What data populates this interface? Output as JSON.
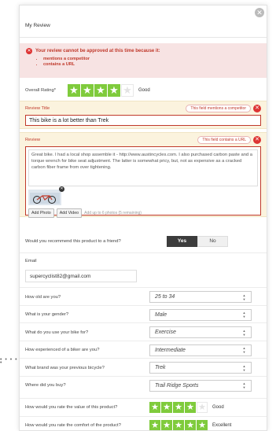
{
  "window": {
    "title": "My Review"
  },
  "alert": {
    "heading": "Your review cannot be approved at this time because it:",
    "reasons": [
      "mentions a competitor",
      "contains a URL"
    ]
  },
  "overall_rating": {
    "label": "Overall Rating*",
    "stars": 4,
    "max": 5,
    "text": "Good"
  },
  "review_title": {
    "label": "Review Title",
    "error": "This field mentions a competitor",
    "value": "This bike is a lot better than Trek"
  },
  "review": {
    "label": "Review",
    "error": "This field contains a URL",
    "value": "Great bike. I had a local shop assemble it - http://www.austincycles.com. I also purchased carbon paste and a torque wrench for bike seat adjustment. The latter is somewhat pricy, but, not as expensive as a cracked carbon fiber frame from over tightening.",
    "add_photo": "Add Photo",
    "add_video": "Add Video",
    "photo_hint": "Add up to 6 photos (5 remaining)"
  },
  "recommend": {
    "question": "Would you recommend this product to a friend?",
    "yes": "Yes",
    "no": "No",
    "selected": "Yes"
  },
  "email": {
    "label": "Email",
    "value": "supercyclist82@gmail.com"
  },
  "questions": [
    {
      "label": "How old are you?",
      "value": "25 to 34"
    },
    {
      "label": "What is your gender?",
      "value": "Male"
    },
    {
      "label": "What do you use your bike for?",
      "value": "Exercise"
    },
    {
      "label": "How experienced of a biker are you?",
      "value": "Intermediate"
    },
    {
      "label": "What brand was your previous bicycle?",
      "value": "Trek"
    },
    {
      "label": "Where did you buy?",
      "value": "Trail Ridge Sports"
    }
  ],
  "value_rating": {
    "label": "How would you rate the value of this product?",
    "stars": 4,
    "max": 5,
    "text": "Good"
  },
  "comfort_rating": {
    "label": "How would you rate the comfort of the product?",
    "stars": 5,
    "max": 5,
    "text": "Excellent"
  },
  "icons": {
    "close": "close-icon",
    "error": "error-icon",
    "select": "select-arrow-icon",
    "star": "star-icon"
  },
  "colors": {
    "error": "#c0392b",
    "star": "#7fcb3c",
    "field_highlight": "#fbf3de",
    "alert_bg": "#f7e3e3"
  }
}
